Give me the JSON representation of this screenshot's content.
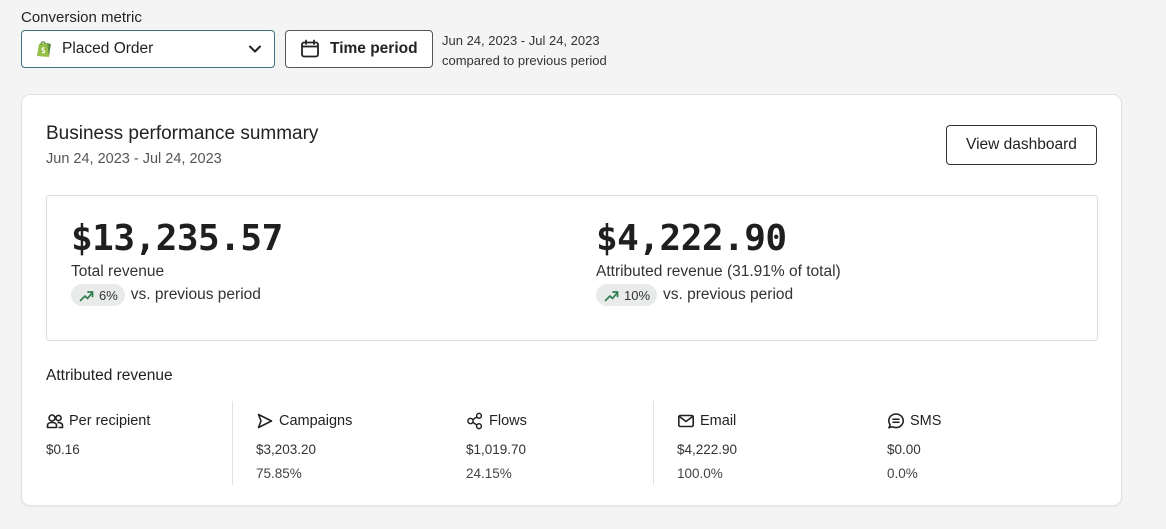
{
  "header": {
    "metric_label": "Conversion metric",
    "metric_value": "Placed Order",
    "time_button": "Time period",
    "period_range": "Jun 24, 2023 - Jul 24, 2023",
    "period_compare": "compared to previous period"
  },
  "card": {
    "title": "Business performance summary",
    "subtitle": "Jun 24, 2023 - Jul 24, 2023",
    "view_button": "View dashboard",
    "total": {
      "amount": "$13,235.57",
      "label": "Total revenue",
      "change": "6%",
      "compare": "vs. previous period"
    },
    "attributed": {
      "amount": "$4,222.90",
      "label": "Attributed revenue (31.91% of total)",
      "change": "10%",
      "compare": "vs. previous period"
    },
    "attributed_title": "Attributed revenue",
    "columns": [
      {
        "label": "Per recipient",
        "value": "$0.16",
        "percent": "",
        "icon": "people-icon"
      },
      {
        "label": "Campaigns",
        "value": "$3,203.20",
        "percent": "75.85%",
        "icon": "send-icon"
      },
      {
        "label": "Flows",
        "value": "$1,019.70",
        "percent": "24.15%",
        "icon": "flow-icon"
      },
      {
        "label": "Email",
        "value": "$4,222.90",
        "percent": "100.0%",
        "icon": "mail-icon"
      },
      {
        "label": "SMS",
        "value": "$0.00",
        "percent": "0.0%",
        "icon": "sms-icon"
      }
    ]
  },
  "colors": {
    "trend_up": "#2e7d4f",
    "select_border": "#3f6f7c",
    "shopify_green": "#95bf47"
  }
}
